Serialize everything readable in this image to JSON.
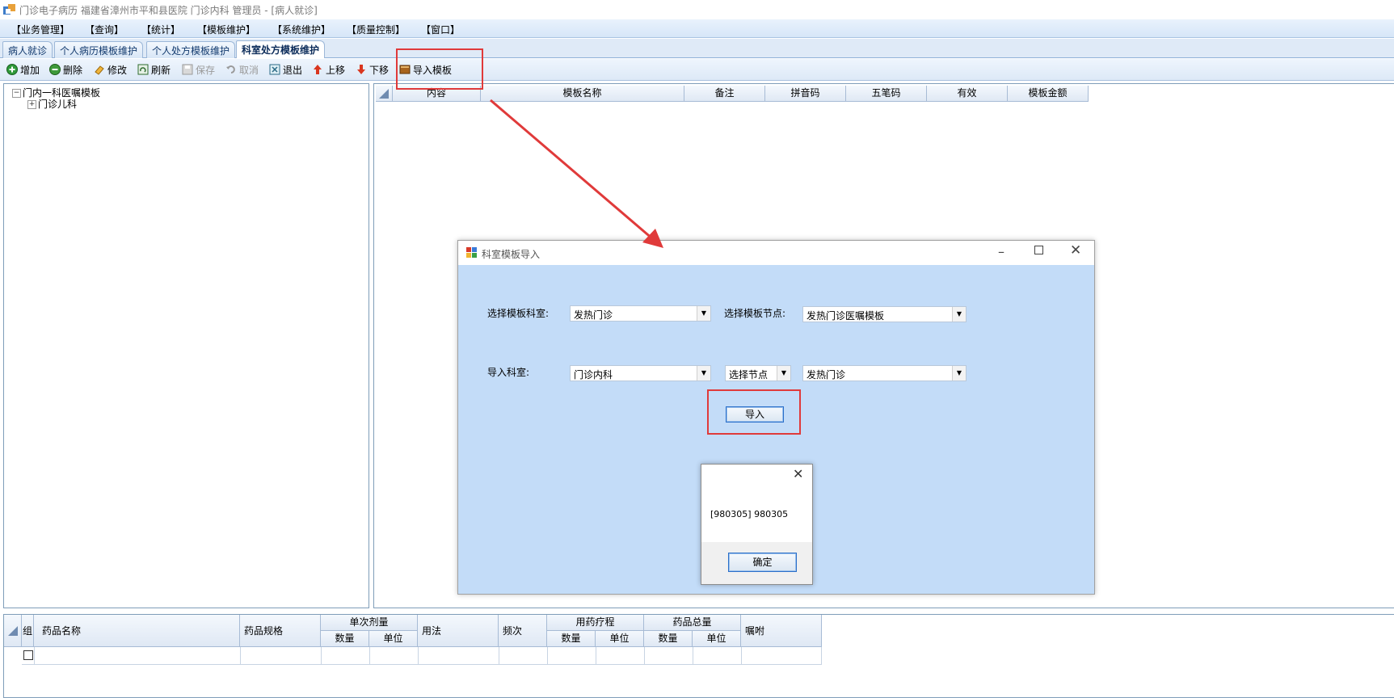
{
  "window": {
    "title": "门诊电子病历  福建省漳州市平和县医院  门诊内科  管理员 - [病人就诊]"
  },
  "menu": [
    "【业务管理】",
    "【查询】",
    "【统计】",
    "【模板维护】",
    "【系统维护】",
    "【质量控制】",
    "【窗口】"
  ],
  "tabs": [
    "病人就诊",
    "个人病历模板维护",
    "个人处方模板维护",
    "科室处方模板维护"
  ],
  "active_tab": "科室处方模板维护",
  "toolbar": {
    "add": "增加",
    "delete": "删除",
    "edit": "修改",
    "refresh": "刷新",
    "save": "保存",
    "cancel": "取消",
    "exit": "退出",
    "move_up": "上移",
    "move_down": "下移",
    "import_template": "导入模板"
  },
  "tree": {
    "root": "门内一科医嘱模板",
    "child": "门诊儿科"
  },
  "template_grid": {
    "columns": [
      "内容",
      "模板名称",
      "备注",
      "拼音码",
      "五笔码",
      "有效",
      "模板金额"
    ]
  },
  "bottom_grid": {
    "group": "组",
    "drug_name": "药品名称",
    "drug_spec": "药品规格",
    "single_dose": "单次剂量",
    "usage": "用法",
    "frequency": "频次",
    "course": "用药疗程",
    "total": "药品总量",
    "instructions": "嘱咐",
    "qty": "数量",
    "unit": "单位"
  },
  "dialog": {
    "title": "科室模板导入",
    "select_dept_label": "选择模板科室:",
    "select_dept_value": "发热门诊",
    "select_node_label": "选择模板节点:",
    "select_node_value": "发热门诊医嘱模板",
    "import_dept_label": "导入科室:",
    "import_dept_value": "门诊内科",
    "node_select_value": "选择节点",
    "node_value": "发热门诊",
    "import_button": "导入"
  },
  "message_box": {
    "text": "[980305] 980305",
    "ok_button": "确定"
  },
  "colors": {
    "dialog_bg": "#c3dcf8",
    "highlight_red": "#e03a3a",
    "button_border": "#2a6fc9"
  }
}
